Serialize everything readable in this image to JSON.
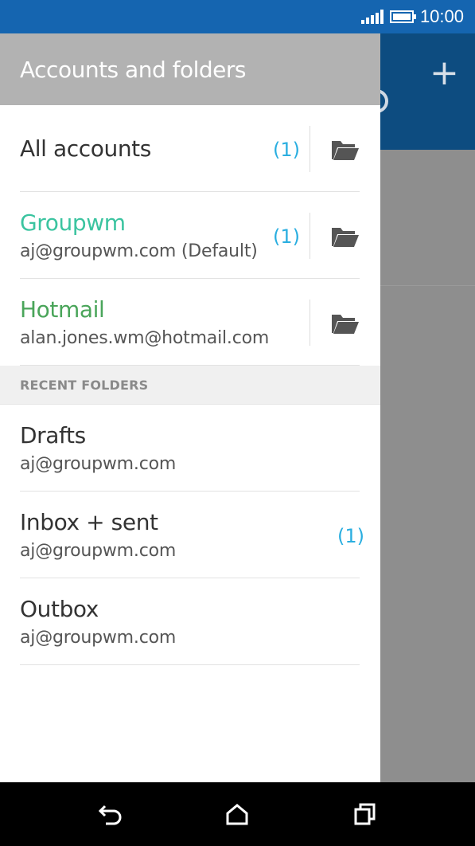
{
  "status_bar": {
    "time": "10:00",
    "icons": [
      "signal-icon",
      "battery-icon"
    ],
    "color": "#1565b0"
  },
  "background_app": {
    "toolbar_color": "#0d4c80",
    "icons": [
      "search-icon",
      "add-icon"
    ]
  },
  "drawer": {
    "title": "Accounts and folders",
    "header_color": "#b2b2b2",
    "accounts": [
      {
        "name": "All accounts",
        "count": "(1)"
      },
      {
        "name": "Groupwm",
        "email": "aj@groupwm.com (Default)",
        "count": "(1)",
        "color": "#3bc4a0"
      },
      {
        "name": "Hotmail",
        "email": "alan.jones.wm@hotmail.com",
        "color": "#4aa55a"
      }
    ],
    "recent_header": "RECENT FOLDERS",
    "recent_folders": [
      {
        "name": "Drafts",
        "email": "aj@groupwm.com"
      },
      {
        "name": "Inbox + sent",
        "email": "aj@groupwm.com",
        "count": "(1)"
      },
      {
        "name": "Outbox",
        "email": "aj@groupwm.com"
      }
    ],
    "count_color": "#2aaee0"
  },
  "nav_bar": {
    "buttons": [
      "back-icon",
      "home-icon",
      "recents-icon"
    ]
  }
}
